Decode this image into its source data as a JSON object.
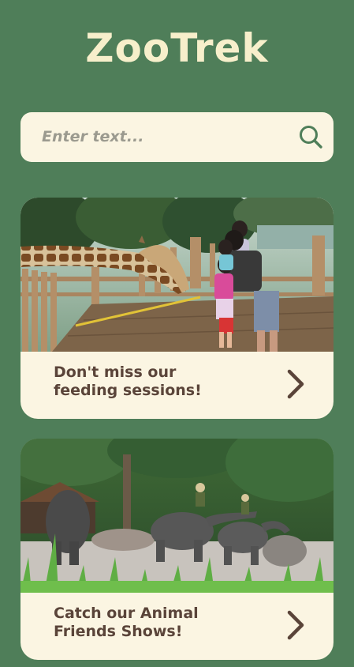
{
  "app": {
    "title": "ZooTrek"
  },
  "search": {
    "placeholder": "Enter text...",
    "icon": "search-icon"
  },
  "cards": [
    {
      "image_subject": "giraffe-feeding-photo",
      "title_line1": "Don't miss our",
      "title_line2": "feeding sessions!",
      "action_icon": "chevron-right-icon"
    },
    {
      "image_subject": "elephant-show-photo",
      "title_line1": "Catch our Animal",
      "title_line2": "Friends Shows!",
      "action_icon": "chevron-right-icon"
    }
  ],
  "colors": {
    "background": "#4f7e59",
    "logo": "#f7efcb",
    "surface": "#fbf5e2",
    "card_text": "#5a4439",
    "search_icon": "#4f7e59"
  }
}
